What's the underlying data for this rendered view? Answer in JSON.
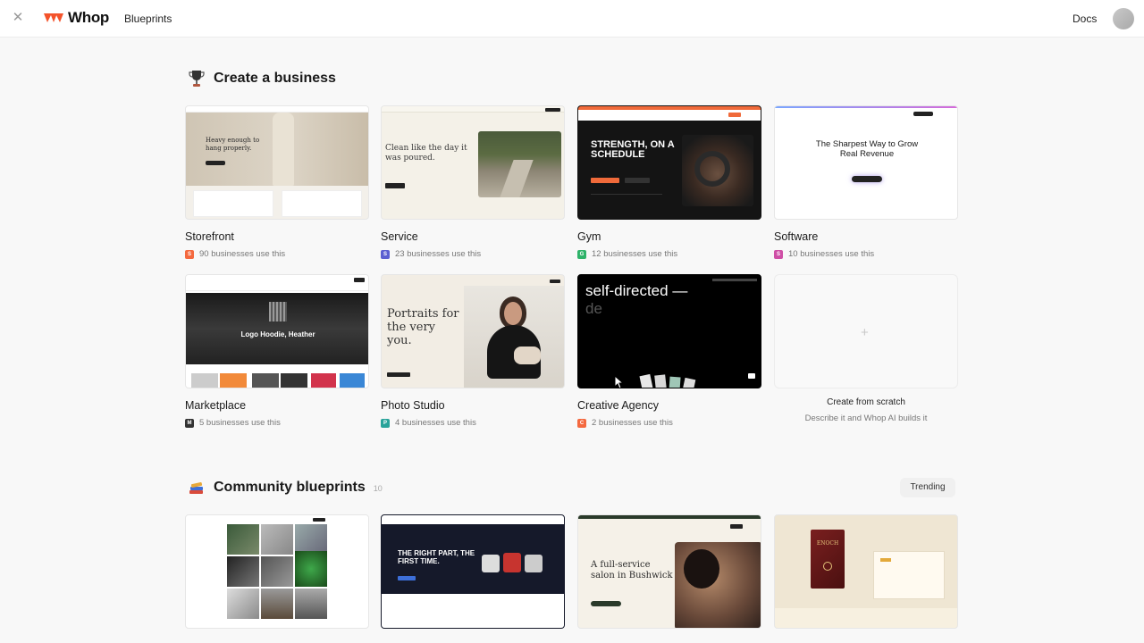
{
  "header": {
    "brand": "Whop",
    "breadcrumb": "Blueprints",
    "docs": "Docs"
  },
  "create_section": {
    "title": "Create a business",
    "cards": [
      {
        "title": "Storefront",
        "badge": "S",
        "badge_color": "#f4693f",
        "meta": "90 businesses use this",
        "preview_text": "Heavy enough to hang properly."
      },
      {
        "title": "Service",
        "badge": "S",
        "badge_color": "#5b5fd1",
        "meta": "23 businesses use this",
        "preview_text": "Clean like the day it was poured."
      },
      {
        "title": "Gym",
        "badge": "G",
        "badge_color": "#2fb36a",
        "meta": "12 businesses use this",
        "preview_text": "STRENGTH, ON A SCHEDULE"
      },
      {
        "title": "Software",
        "badge": "S",
        "badge_color": "#cf4fa6",
        "meta": "10 businesses use this",
        "preview_text": "The Sharpest Way to Grow Real Revenue"
      },
      {
        "title": "Marketplace",
        "badge": "M",
        "badge_color": "#333333",
        "meta": "5 businesses use this",
        "preview_text": "Logo Hoodie, Heather"
      },
      {
        "title": "Photo Studio",
        "badge": "P",
        "badge_color": "#29a39a",
        "meta": "4 businesses use this",
        "preview_text": "Portraits for the very you."
      },
      {
        "title": "Creative Agency",
        "badge": "C",
        "badge_color": "#f4693f",
        "meta": "2 businesses use this",
        "preview_text": "self-directed —",
        "preview_text_2": "de"
      }
    ],
    "scratch": {
      "title": "Create from scratch",
      "subtitle": "Describe it and Whop AI builds it"
    }
  },
  "community_section": {
    "title": "Community blueprints",
    "count": "10",
    "sort": "Trending",
    "cards": [
      {
        "preview_text": ""
      },
      {
        "preview_text": "THE RIGHT PART, THE FIRST TIME."
      },
      {
        "preview_text": "A full-service salon in Bushwick"
      },
      {
        "preview_text": "ENOCH"
      }
    ]
  }
}
